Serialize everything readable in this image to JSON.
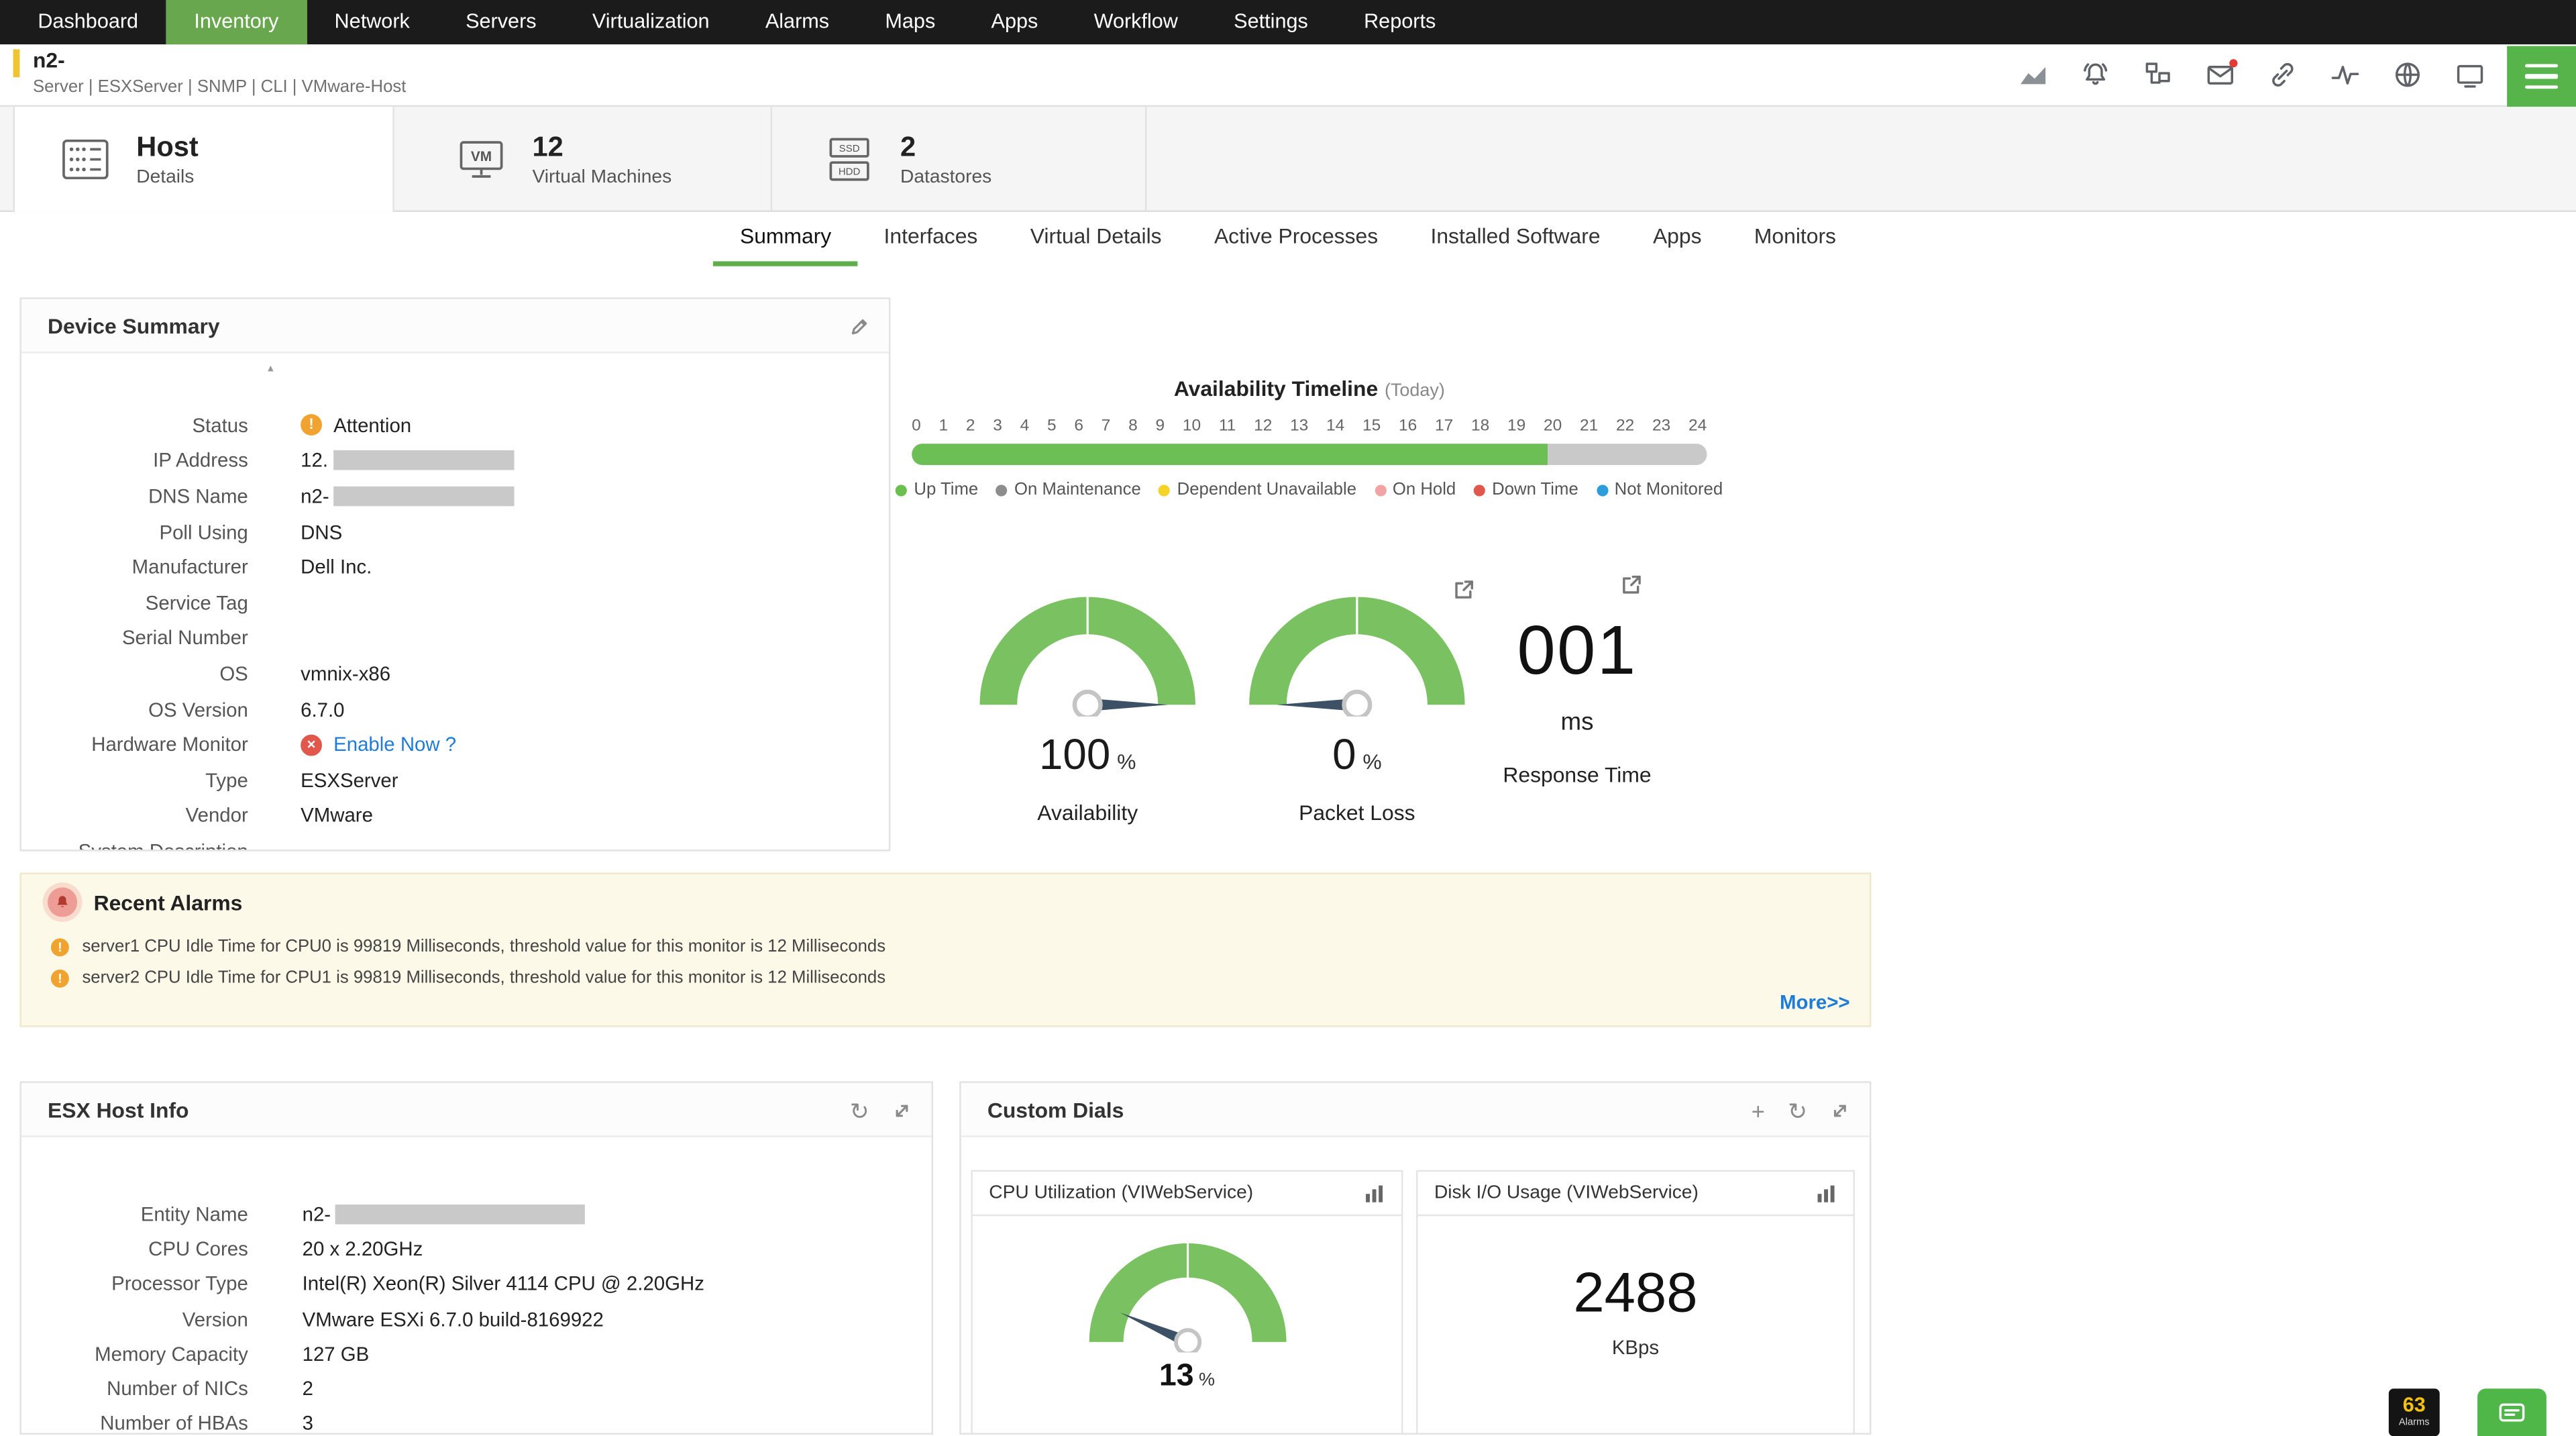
{
  "nav": {
    "items": [
      "Dashboard",
      "Inventory",
      "Network",
      "Servers",
      "Virtualization",
      "Alarms",
      "Maps",
      "Apps",
      "Workflow",
      "Settings",
      "Reports"
    ],
    "active_item": "Inventory"
  },
  "device_header": {
    "name": "n2-",
    "meta": "Server | ESXServer  | SNMP  | CLI  | VMware-Host"
  },
  "tabs": {
    "host": {
      "title": "Host",
      "subtitle": "Details"
    },
    "virtual_machines": {
      "count": "12",
      "label": "Virtual Machines"
    },
    "datastores": {
      "count": "2",
      "label": "Datastores"
    }
  },
  "subnav": {
    "items": [
      "Summary",
      "Interfaces",
      "Virtual Details",
      "Active Processes",
      "Installed Software",
      "Apps",
      "Monitors"
    ],
    "active_item": "Summary"
  },
  "device_summary": {
    "title": "Device Summary",
    "status": {
      "label": "Status",
      "value": "Attention"
    },
    "ip_address": {
      "label": "IP Address",
      "value": "12."
    },
    "dns_name": {
      "label": "DNS Name",
      "value": "n2-"
    },
    "poll_using": {
      "label": "Poll Using",
      "value": "DNS"
    },
    "manufacturer": {
      "label": "Manufacturer",
      "value": "Dell Inc."
    },
    "service_tag": {
      "label": "Service Tag",
      "value": ""
    },
    "serial_number": {
      "label": "Serial Number",
      "value": ""
    },
    "os": {
      "label": "OS",
      "value": "vmnix-x86"
    },
    "os_version": {
      "label": "OS Version",
      "value": "6.7.0"
    },
    "hardware_monitor": {
      "label": "Hardware Monitor",
      "link": "Enable Now ?"
    },
    "type": {
      "label": "Type",
      "value": "ESXServer"
    },
    "vendor": {
      "label": "Vendor",
      "value": "VMware"
    },
    "system_description": {
      "label": "System Description",
      "value": ""
    }
  },
  "availability_timeline": {
    "title": "Availability Timeline",
    "subtitle": "(Today)",
    "hours": [
      "0",
      "1",
      "2",
      "3",
      "4",
      "5",
      "6",
      "7",
      "8",
      "9",
      "10",
      "11",
      "12",
      "13",
      "14",
      "15",
      "16",
      "17",
      "18",
      "19",
      "20",
      "21",
      "22",
      "23",
      "24"
    ],
    "uptime_width": "80%",
    "legend": [
      {
        "label": "Up Time",
        "color": "#6abf4e"
      },
      {
        "label": "On Maintenance",
        "color": "#8d8d8d"
      },
      {
        "label": "Dependent Unavailable",
        "color": "#f5d327"
      },
      {
        "label": "On Hold",
        "color": "#f2a4a4"
      },
      {
        "label": "Down Time",
        "color": "#e2574c"
      },
      {
        "label": "Not Monitored",
        "color": "#2d9cdb"
      }
    ]
  },
  "gauges": {
    "availability": {
      "value": "100",
      "unit": "%",
      "label": "Availability",
      "percent": 100
    },
    "packet_loss": {
      "value": "0",
      "unit": "%",
      "label": "Packet Loss",
      "percent": 0
    },
    "response_time": {
      "value": "001",
      "unit": "ms",
      "label": "Response Time"
    }
  },
  "recent_alarms": {
    "title": "Recent Alarms",
    "items": [
      "server1 CPU Idle Time for CPU0 is 99819 Milliseconds, threshold value for this monitor is 12 Milliseconds",
      "server2 CPU Idle Time for CPU1 is 99819 Milliseconds, threshold value for this monitor is 12 Milliseconds"
    ],
    "more_link": "More>>"
  },
  "esx_host_info": {
    "title": "ESX Host Info",
    "entity_name": {
      "label": "Entity Name",
      "value": "n2-"
    },
    "cpu_cores": {
      "label": "CPU Cores",
      "value": "20 x 2.20GHz"
    },
    "processor_type": {
      "label": "Processor Type",
      "value": "Intel(R) Xeon(R) Silver 4114 CPU @ 2.20GHz"
    },
    "version": {
      "label": "Version",
      "value": "VMware ESXi 6.7.0 build-8169922"
    },
    "memory_capacity": {
      "label": "Memory Capacity",
      "value": "127 GB"
    },
    "number_of_nics": {
      "label": "Number of NICs",
      "value": "2"
    },
    "number_of_hbas": {
      "label": "Number of HBAs",
      "value": "3"
    }
  },
  "custom_dials": {
    "title": "Custom Dials",
    "cpu_utilization": {
      "title": "CPU Utilization (VIWebService)",
      "value": "13",
      "unit": "%",
      "percent": 13
    },
    "disk_io": {
      "title": "Disk I/O Usage (VIWebService)",
      "value": "2488",
      "unit": "KBps"
    }
  },
  "footer": {
    "alarm_count": "63",
    "alarm_label": "Alarms"
  },
  "icons": {
    "warning_glyph": "!",
    "error_glyph": "×",
    "plus_glyph": "+",
    "refresh_glyph": "↻",
    "scroll_up_glyph": "▴",
    "vm_icon_label": "VM",
    "ssd_icon_label": "SSD",
    "hdd_icon_label": "HDD"
  },
  "colors": {
    "accent_green": "#69a74e",
    "gauge_green": "#7ac161",
    "needle": "#3d5166",
    "uptime_green": "#6cbf54",
    "link_blue": "#1f7cd6",
    "warning_orange": "#f0a32f",
    "error_red": "#e2574c",
    "header_accent_yellow": "#f0c330",
    "alarm_badge_yellow": "#f2c011"
  }
}
